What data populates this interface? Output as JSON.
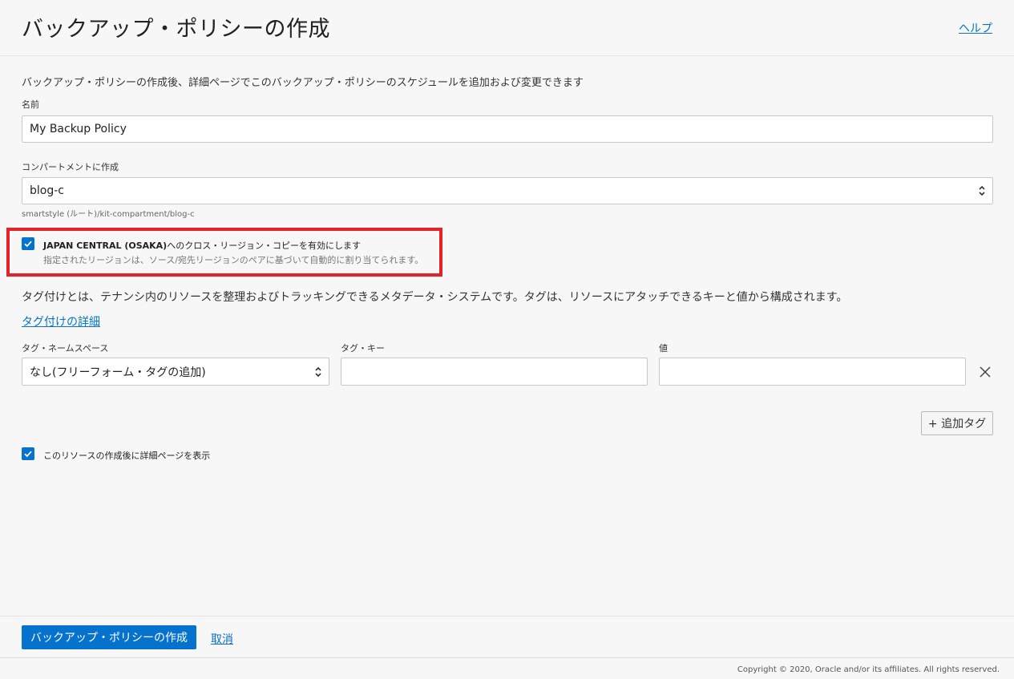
{
  "header": {
    "title": "バックアップ・ポリシーの作成",
    "help": "ヘルプ"
  },
  "form": {
    "intro": "バックアップ・ポリシーの作成後、詳細ページでこのバックアップ・ポリシーのスケジュールを追加および変更できます",
    "name_label": "名前",
    "name_value": "My Backup Policy",
    "compartment_label": "コンパートメントに作成",
    "compartment_value": "blog-c",
    "compartment_path": "smartstyle (ルート)/kit-compartment/blog-c"
  },
  "cross_region": {
    "checked": true,
    "label_bold": "JAPAN CENTRAL (OSAKA)",
    "label_rest": "へのクロス・リージョン・コピーを有効にします",
    "description": "指定されたリージョンは、ソース/宛先リージョンのペアに基づいて自動的に割り当てられます。"
  },
  "tags": {
    "description": "タグ付けとは、テナンシ内のリソースを整理およびトラッキングできるメタデータ・システムです。タグは、リソースにアタッチできるキーと値から構成されます。",
    "learn_more": "タグ付けの詳細",
    "namespace_label": "タグ・ネームスペース",
    "namespace_value": "なし(フリーフォーム・タグの追加)",
    "key_label": "タグ・キー",
    "key_value": "",
    "value_label": "値",
    "value_value": "",
    "add_tag": "+ 追加タグ"
  },
  "view_details": {
    "checked": true,
    "label": "このリソースの作成後に詳細ページを表示"
  },
  "footer": {
    "create_button": "バックアップ・ポリシーの作成",
    "cancel": "取消",
    "copyright": "Copyright © 2020, Oracle and/or its affiliates. All rights reserved."
  },
  "colors": {
    "primary": "#0572ce",
    "highlight": "#e3232a"
  },
  "icons": [
    "chevron-updown-icon",
    "checkmark-icon",
    "close-icon"
  ]
}
